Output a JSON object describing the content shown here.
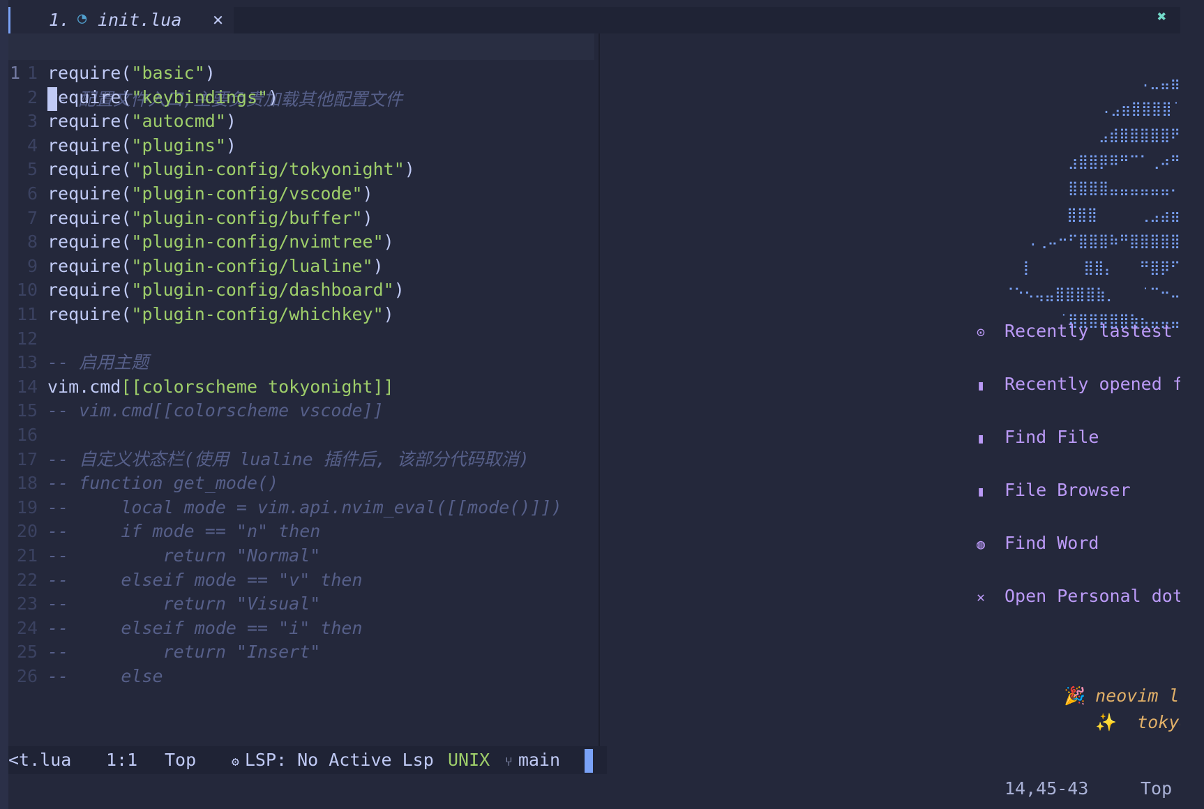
{
  "tabline": {
    "tab_number": "1.",
    "tab_file_icon": "lua-file-icon",
    "tab_filename": "init.lua",
    "tab_close": "✕",
    "quit_icon": "✖"
  },
  "editor": {
    "current_line": {
      "number": "1",
      "text": "- 配置文件入口,主要负责加载其他配置文件"
    },
    "lines": [
      {
        "n": "1",
        "kind": "req",
        "fn": "require",
        "arg": "\"basic\""
      },
      {
        "n": "2",
        "kind": "req",
        "fn": "require",
        "arg": "\"keybindings\""
      },
      {
        "n": "3",
        "kind": "req",
        "fn": "require",
        "arg": "\"autocmd\""
      },
      {
        "n": "4",
        "kind": "req",
        "fn": "require",
        "arg": "\"plugins\""
      },
      {
        "n": "5",
        "kind": "req",
        "fn": "require",
        "arg": "\"plugin-config/tokyonight\""
      },
      {
        "n": "6",
        "kind": "req",
        "fn": "require",
        "arg": "\"plugin-config/vscode\""
      },
      {
        "n": "7",
        "kind": "req",
        "fn": "require",
        "arg": "\"plugin-config/buffer\""
      },
      {
        "n": "8",
        "kind": "req",
        "fn": "require",
        "arg": "\"plugin-config/nvimtree\""
      },
      {
        "n": "9",
        "kind": "req",
        "fn": "require",
        "arg": "\"plugin-config/lualine\""
      },
      {
        "n": "10",
        "kind": "req",
        "fn": "require",
        "arg": "\"plugin-config/dashboard\""
      },
      {
        "n": "11",
        "kind": "req",
        "fn": "require",
        "arg": "\"plugin-config/whichkey\""
      },
      {
        "n": "12",
        "kind": "blank",
        "text": ""
      },
      {
        "n": "13",
        "kind": "comment",
        "text": "-- 启用主题"
      },
      {
        "n": "14",
        "kind": "cmd",
        "fn": "vim.cmd",
        "arg": "[[colorscheme tokyonight]]"
      },
      {
        "n": "15",
        "kind": "comment",
        "text": "-- vim.cmd[[colorscheme vscode]]"
      },
      {
        "n": "16",
        "kind": "blank",
        "text": ""
      },
      {
        "n": "17",
        "kind": "comment",
        "text": "-- 自定义状态栏(使用 lualine 插件后, 该部分代码取消)"
      },
      {
        "n": "18",
        "kind": "comment",
        "text": "-- function get_mode()"
      },
      {
        "n": "19",
        "kind": "comment",
        "text": "--     local mode = vim.api.nvim_eval([[mode()]])"
      },
      {
        "n": "20",
        "kind": "comment",
        "text": "--     if mode == \"n\" then"
      },
      {
        "n": "21",
        "kind": "comment",
        "text": "--         return \"Normal\""
      },
      {
        "n": "22",
        "kind": "comment",
        "text": "--     elseif mode == \"v\" then"
      },
      {
        "n": "23",
        "kind": "comment",
        "text": "--         return \"Visual\""
      },
      {
        "n": "24",
        "kind": "comment",
        "text": "--     elseif mode == \"i\" then"
      },
      {
        "n": "25",
        "kind": "comment",
        "text": "--         return \"Insert\""
      },
      {
        "n": "26",
        "kind": "comment",
        "text": "--     else"
      }
    ]
  },
  "dashboard": {
    "logo_lines": [
      ".⣀⣤⣶",
      ".⣠⣶⣿⣿⣿⣿˙",
      "⣠⣾⣿⣿⣿⣿⣿⠟",
      "⣰⣿⣿⡿⠿⠛⠉⠁⢀⠴⠛",
      "⣿⣿⣿⣿⣤⣤⣤⣤⣤⣤⠄",
      "⣿⣿⣿     ⢀⣠⣴⣶",
      ".⢀⠤⠒⠋⣿⣿⣿⠷⠛⣿⣿⣿⣿⣿",
      "⡇      ⣿⣿⡄   ⠛⣿⡿⠋",
      "⠈⠑⠢⢤⣤⣿⣿⣿⣿⣷⡀   ˙⠉⠒⠤",
      "˙⣿⣿⣿⣿⣿⣿⣷⣦⣤⣤⣤"
    ],
    "items": [
      {
        "icon": "history-icon",
        "glyph": "⊙",
        "label": "Recently lastest"
      },
      {
        "icon": "file-copy-icon",
        "glyph": "▮",
        "label": "Recently opened f"
      },
      {
        "icon": "file-icon",
        "glyph": "▮",
        "label": "Find File"
      },
      {
        "icon": "file-browser-icon",
        "glyph": "▮",
        "label": "File Browser"
      },
      {
        "icon": "find-word-icon",
        "glyph": "◍",
        "label": "Find Word"
      },
      {
        "icon": "tools-icon",
        "glyph": "✕",
        "label": "Open Personal dot"
      }
    ],
    "footer": [
      {
        "icon": "party-icon",
        "glyph": "🎉",
        "text": "neovim lo"
      },
      {
        "icon": "sparkles-icon",
        "glyph": "✨",
        "text": " tokyo"
      }
    ]
  },
  "statusline": {
    "filename": "<t.lua",
    "position": "1:1",
    "scroll": "Top",
    "lsp_icon": "gear-icon",
    "lsp": "LSP: No Active Lsp",
    "encoding": "UNIX",
    "git_icon": "git-branch-icon",
    "branch": "main"
  },
  "cmdline": {
    "ruler": "14,45-43",
    "scroll": "Top"
  },
  "colors": {
    "background": "#24283b",
    "string": "#9ece6a",
    "comment": "#565f89",
    "accent": "#bb9af7",
    "logo": "#7aa2f7",
    "footer": "#e0af68"
  }
}
